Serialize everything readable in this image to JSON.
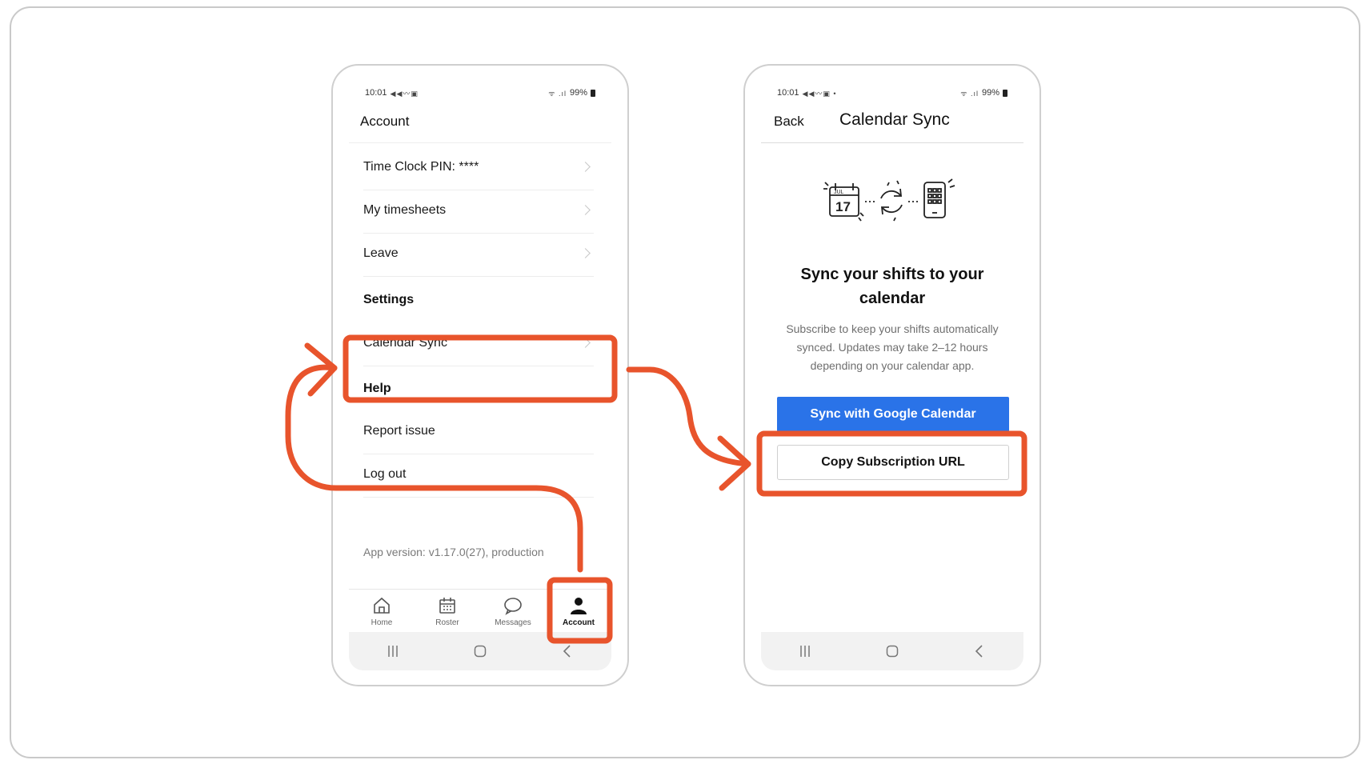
{
  "colors": {
    "annotation": "#e8542c",
    "google_button": "#2a73e8",
    "frame_border": "#c9c9c9"
  },
  "left_phone": {
    "status": {
      "time": "10:01",
      "left_icons": "◀◀〰▣",
      "signal_icons": "ᯤ .ıl",
      "battery": "99%"
    },
    "header_title": "Account",
    "rows": [
      {
        "label": "Time Clock PIN: ****",
        "icon": "chevron-right-icon"
      },
      {
        "label": "My timesheets",
        "icon": "chevron-right-icon"
      },
      {
        "label": "Leave",
        "icon": "chevron-right-icon"
      }
    ],
    "settings_title": "Settings",
    "calendar_sync_label": "Calendar Sync",
    "help_title": "Help",
    "report_issue_label": "Report issue",
    "logout_label": "Log out",
    "version_text": "App version: v1.17.0(27), production",
    "tabs": [
      {
        "label": "Home",
        "icon": "home-icon"
      },
      {
        "label": "Roster",
        "icon": "calendar-icon"
      },
      {
        "label": "Messages",
        "icon": "chat-bubble-icon"
      },
      {
        "label": "Account",
        "icon": "user-icon",
        "active": true
      }
    ]
  },
  "right_phone": {
    "status": {
      "time": "10:01",
      "left_icons": "◀◀〰▣ •",
      "signal_icons": "ᯤ .ıl",
      "battery": "99%"
    },
    "back_label": "Back",
    "title": "Calendar Sync",
    "illustration": {
      "calendar_month": "JUL",
      "calendar_day": "17"
    },
    "heading": "Sync your shifts to your calendar",
    "description": "Subscribe to keep your shifts automatically synced. Updates may take 2–12 hours depending on your calendar app.",
    "google_button_label": "Sync with Google Calendar",
    "copy_button_label": "Copy Subscription URL"
  }
}
